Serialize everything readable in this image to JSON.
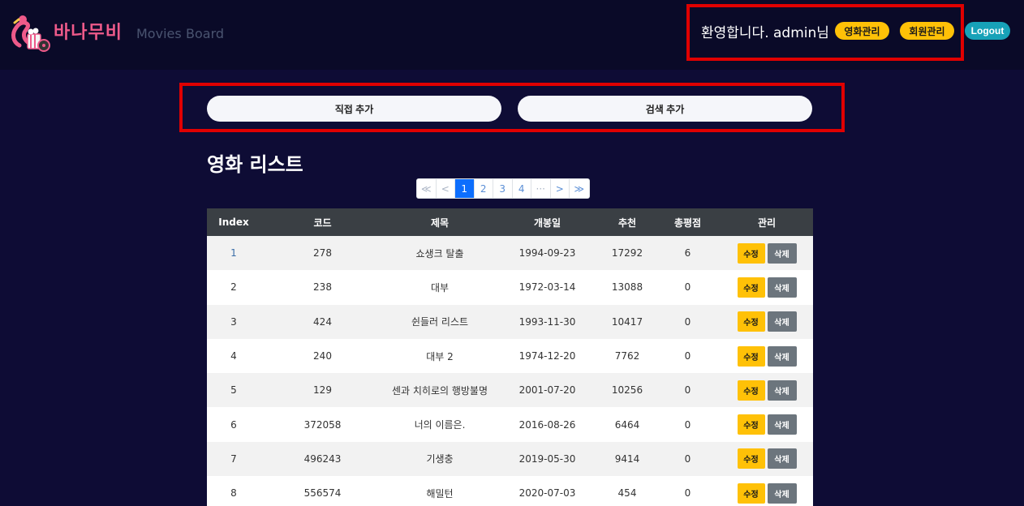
{
  "header": {
    "brand": "바나무비",
    "nav": [
      "Movies",
      "Board"
    ],
    "welcome": "환영합니다. admin님",
    "movie_admin": "영화관리",
    "member_admin": "회원관리",
    "logout": "Logout"
  },
  "add": {
    "direct": "직접 추가",
    "search": "검색 추가"
  },
  "title": "영화 리스트",
  "pagination": [
    "≪",
    "<",
    "1",
    "2",
    "3",
    "4",
    "···",
    ">",
    "≫"
  ],
  "table": {
    "columns": [
      "Index",
      "코드",
      "제목",
      "개봉일",
      "추천",
      "총평점",
      "관리"
    ],
    "edit_label": "수정",
    "delete_label": "삭제",
    "rows": [
      [
        "1",
        "278",
        "쇼생크 탈출",
        "1994-09-23",
        "17292",
        "6"
      ],
      [
        "2",
        "238",
        "대부",
        "1972-03-14",
        "13088",
        "0"
      ],
      [
        "3",
        "424",
        "쉰들러 리스트",
        "1993-11-30",
        "10417",
        "0"
      ],
      [
        "4",
        "240",
        "대부 2",
        "1974-12-20",
        "7762",
        "0"
      ],
      [
        "5",
        "129",
        "센과 치히로의 행방불명",
        "2001-07-20",
        "10256",
        "0"
      ],
      [
        "6",
        "372058",
        "너의 이름은.",
        "2016-08-26",
        "6464",
        "0"
      ],
      [
        "7",
        "496243",
        "기생충",
        "2019-05-30",
        "9414",
        "0"
      ],
      [
        "8",
        "556574",
        "해밀턴",
        "2020-07-03",
        "454",
        "0"
      ]
    ]
  },
  "colors": {
    "background": "#0e0c35",
    "accent_yellow": "#ffc107",
    "logout_teal": "#17a2b8",
    "brand_pink": "#ee5a8a",
    "highlight_red": "#e00000"
  }
}
